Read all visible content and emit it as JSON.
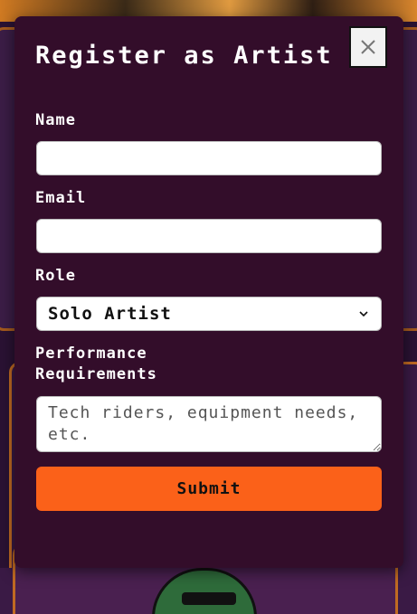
{
  "modal": {
    "title": "Register as Artist",
    "close_icon": "close-icon",
    "fields": {
      "name": {
        "label": "Name",
        "value": ""
      },
      "email": {
        "label": "Email",
        "value": ""
      },
      "role": {
        "label": "Role",
        "selected": "Solo Artist"
      },
      "performance": {
        "label": "Performance Requirements",
        "placeholder": "Tech riders, equipment needs, etc."
      }
    },
    "submit_label": "Submit"
  },
  "colors": {
    "modal_bg": "#330d2a",
    "accent": "#fb6119",
    "page_bg": "#2a1233"
  }
}
